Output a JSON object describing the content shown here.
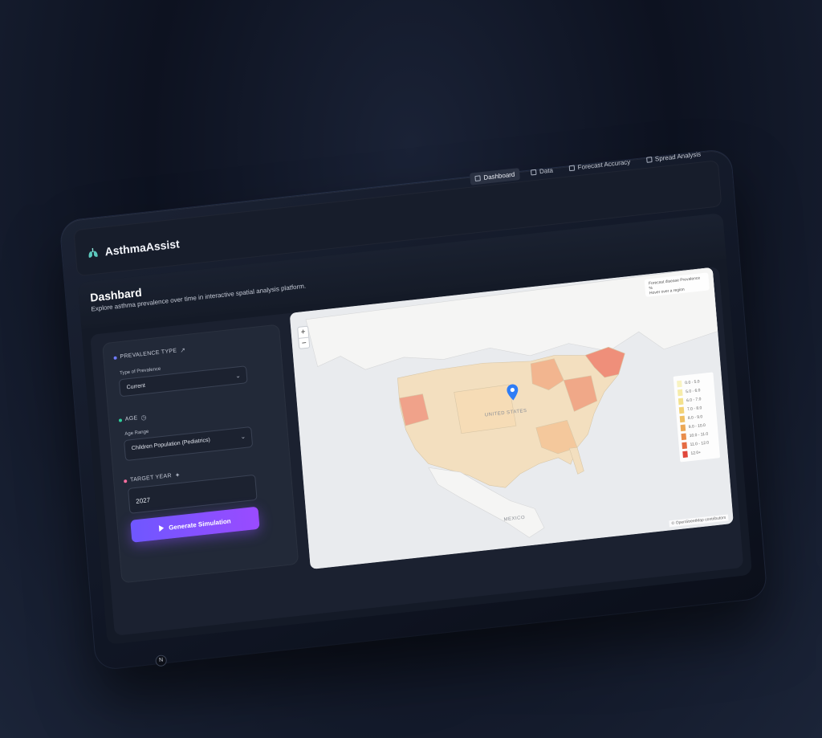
{
  "app": {
    "name": "AsthmaAssist"
  },
  "nav": [
    {
      "label": "Dashboard",
      "icon": "grid-icon",
      "active": true
    },
    {
      "label": "Data",
      "icon": "file-icon",
      "active": false
    },
    {
      "label": "Forecast Accuracy",
      "icon": "chart-icon",
      "active": false
    },
    {
      "label": "Spread Analysis",
      "icon": "spread-icon",
      "active": false
    }
  ],
  "header": {
    "title": "Dashbard",
    "subtitle": "Explore asthma prevalence over time in interactive spatial analysis platform."
  },
  "form": {
    "prevalence": {
      "label": "PREVALENCE TYPE",
      "field_label": "Type of Prevalence",
      "value": "Current"
    },
    "age": {
      "label": "AGE",
      "field_label": "Age Range",
      "value": "Children Population (Pediatrics)"
    },
    "target": {
      "label": "TARGET YEAR",
      "value": "2027"
    },
    "button_label": "Generate Simulation"
  },
  "map": {
    "zoom_in": "+",
    "zoom_out": "−",
    "tooltip_title": "Forecast disease Prevalence %",
    "tooltip_sub": "Hover over a region",
    "region_labels": [
      "UNITED STATES",
      "MEXICO"
    ],
    "legend": [
      {
        "label": "0.0 - 5.0",
        "color": "#f8f3c2"
      },
      {
        "label": "5.0 - 6.0",
        "color": "#f6ecaa"
      },
      {
        "label": "6.0 - 7.0",
        "color": "#f3e18d"
      },
      {
        "label": "7.0 - 8.0",
        "color": "#f2d276"
      },
      {
        "label": "8.0 - 9.0",
        "color": "#efbf63"
      },
      {
        "label": "9.0 - 10.0",
        "color": "#eba856"
      },
      {
        "label": "10.0 - 11.0",
        "color": "#e98d4c"
      },
      {
        "label": "11.0 - 12.0",
        "color": "#e56c43"
      },
      {
        "label": "12.0+",
        "color": "#e0473b"
      }
    ],
    "attribution": "© OpenStreetMap contributors"
  }
}
